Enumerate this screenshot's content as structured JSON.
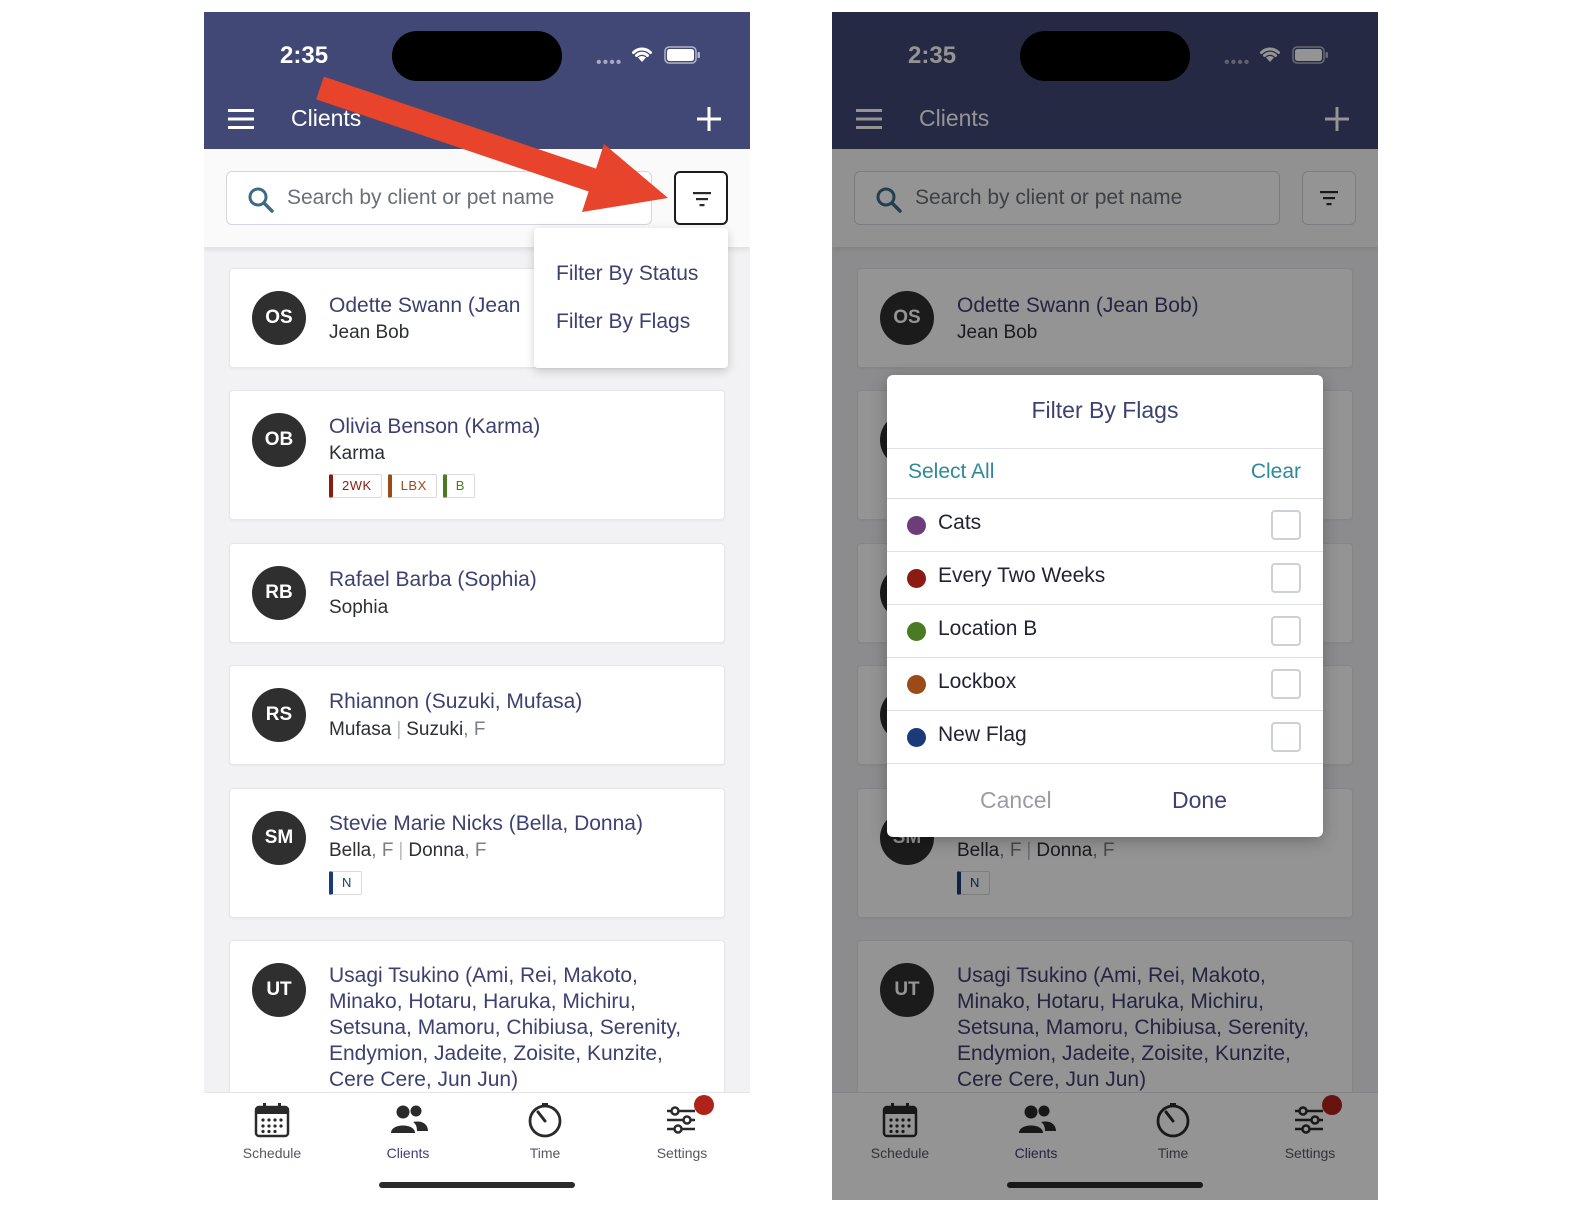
{
  "status": {
    "time": "2:35"
  },
  "header": {
    "title": "Clients"
  },
  "search": {
    "placeholder": "Search by client or pet name"
  },
  "filter_menu": {
    "status": "Filter By Status",
    "flags": "Filter By Flags"
  },
  "clients": [
    {
      "initials": "OS",
      "name": "Odette Swann (Jean Bob)",
      "name_truncated": "Odette Swann (Jean",
      "pets": [
        {
          "name": "Jean Bob"
        }
      ]
    },
    {
      "initials": "OB",
      "name": "Olivia Benson (Karma)",
      "pets": [
        {
          "name": "Karma"
        }
      ],
      "tags": [
        {
          "label": "2WK",
          "color": "#8a1c12"
        },
        {
          "label": "LBX",
          "color": "#9a4b18"
        },
        {
          "label": "B",
          "color": "#4a7a22"
        }
      ]
    },
    {
      "initials": "RB",
      "name": "Rafael Barba (Sophia)",
      "pets": [
        {
          "name": "Sophia"
        }
      ]
    },
    {
      "initials": "RS",
      "name": "Rhiannon (Suzuki, Mufasa)",
      "pets": [
        {
          "name": "Mufasa"
        },
        {
          "name": "Suzuki",
          "sex": "F"
        }
      ]
    },
    {
      "initials": "SM",
      "name": "Stevie Marie Nicks (Bella, Donna)",
      "pets": [
        {
          "name": "Bella",
          "sex": "F"
        },
        {
          "name": "Donna",
          "sex": "F"
        }
      ],
      "tags": [
        {
          "label": "N",
          "color": "#1a3a7a"
        }
      ]
    },
    {
      "initials": "UT",
      "name": "Usagi Tsukino (Ami, Rei, Makoto, Minako, Hotaru, Haruka, Michiru, Setsuna, Mamoru, Chibiusa, Serenity, Endymion, Jadeite, Zoisite, Kunzite, Cere Cere, Jun Jun)"
    }
  ],
  "tabbar": {
    "schedule": "Schedule",
    "clients": "Clients",
    "time": "Time",
    "settings": "Settings"
  },
  "modal": {
    "title": "Filter By Flags",
    "select_all": "Select All",
    "clear": "Clear",
    "flags": [
      {
        "label": "Cats",
        "color": "#6d3d7a",
        "checked": false
      },
      {
        "label": "Every Two Weeks",
        "color": "#8a1c12",
        "checked": false
      },
      {
        "label": "Location B",
        "color": "#4a7a22",
        "checked": false
      },
      {
        "label": "Lockbox",
        "color": "#9a4b18",
        "checked": false
      },
      {
        "label": "New Flag",
        "color": "#1a3a7a",
        "checked": false
      }
    ],
    "cancel": "Cancel",
    "done": "Done"
  },
  "colors": {
    "header": "#414876",
    "accent_text": "#3d4170",
    "teal": "#2e8a99",
    "annotation_arrow": "#e8432b",
    "badge": "#b02318"
  }
}
